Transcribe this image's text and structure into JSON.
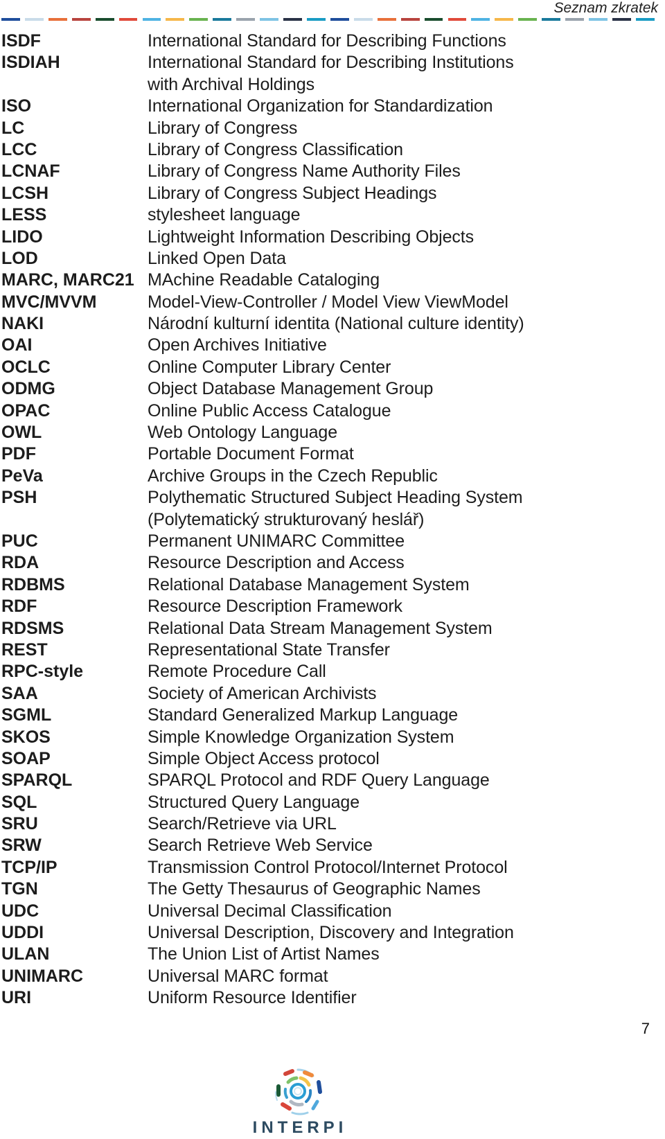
{
  "header": {
    "title": "Seznam zkratek",
    "dash_colors": [
      "#1f4e9c",
      "#c9dbe9",
      "#e8703a",
      "#b8443e",
      "#1a4d2e",
      "#e04a3a",
      "#4fb3e3",
      "#f6b74a",
      "#69b350",
      "#1a7a9c",
      "#9aa3ad",
      "#7ec3e4",
      "#2a3347",
      "#1a9cc4"
    ]
  },
  "abbreviations": [
    {
      "abbr": "ISDF",
      "desc": "International Standard for Describing Functions"
    },
    {
      "abbr": "ISDIAH",
      "desc": "International Standard for Describing Institutions"
    },
    {
      "abbr": "",
      "desc": "with Archival Holdings"
    },
    {
      "abbr": "ISO",
      "desc": "International Organization for Standardization"
    },
    {
      "abbr": "LC",
      "desc": "Library of Congress"
    },
    {
      "abbr": "LCC",
      "desc": "Library of Congress Classification"
    },
    {
      "abbr": "LCNAF",
      "desc": "Library of Congress Name Authority Files"
    },
    {
      "abbr": "LCSH",
      "desc": "Library of Congress Subject Headings"
    },
    {
      "abbr": "LESS",
      "desc": "stylesheet language"
    },
    {
      "abbr": "LIDO",
      "desc": "Lightweight Information Describing Objects"
    },
    {
      "abbr": "LOD",
      "desc": "Linked Open Data"
    },
    {
      "abbr": "MARC, MARC21",
      "desc": "MAchine Readable Cataloging"
    },
    {
      "abbr": "MVC/MVVM",
      "desc": "Model-View-Controller / Model View ViewModel"
    },
    {
      "abbr": "NAKI",
      "desc": "Národní kulturní identita (National culture identity)"
    },
    {
      "abbr": "OAI",
      "desc": "Open Archives Initiative"
    },
    {
      "abbr": "OCLC",
      "desc": "Online Computer Library Center"
    },
    {
      "abbr": "ODMG",
      "desc": "Object Database Management Group"
    },
    {
      "abbr": "OPAC",
      "desc": "Online Public Access Catalogue"
    },
    {
      "abbr": "OWL",
      "desc": "Web Ontology Language"
    },
    {
      "abbr": "PDF",
      "desc": "Portable Document Format"
    },
    {
      "abbr": "PeVa",
      "desc": "Archive Groups in the Czech Republic"
    },
    {
      "abbr": "PSH",
      "desc": "Polythematic Structured Subject Heading System"
    },
    {
      "abbr": "",
      "desc": "(Polytematický strukturovaný heslář)"
    },
    {
      "abbr": "PUC",
      "desc": "Permanent UNIMARC Committee"
    },
    {
      "abbr": "RDA",
      "desc": "Resource Description and Access"
    },
    {
      "abbr": "RDBMS",
      "desc": "Relational Database Management System"
    },
    {
      "abbr": "RDF",
      "desc": "Resource Description Framework"
    },
    {
      "abbr": "RDSMS",
      "desc": "Relational Data Stream Management System"
    },
    {
      "abbr": "REST",
      "desc": "Representational State Transfer"
    },
    {
      "abbr": "RPC-style",
      "desc": "Remote Procedure Call"
    },
    {
      "abbr": "SAA",
      "desc": "Society of American Archivists"
    },
    {
      "abbr": "SGML",
      "desc": "Standard Generalized Markup Language"
    },
    {
      "abbr": "SKOS",
      "desc": "Simple Knowledge Organization System"
    },
    {
      "abbr": "SOAP",
      "desc": "Simple Object Access protocol"
    },
    {
      "abbr": "SPARQL",
      "desc": "SPARQL Protocol and RDF Query Language"
    },
    {
      "abbr": "SQL",
      "desc": "Structured Query Language"
    },
    {
      "abbr": "SRU",
      "desc": "Search/Retrieve via URL"
    },
    {
      "abbr": "SRW",
      "desc": "Search Retrieve Web Service"
    },
    {
      "abbr": "TCP/IP",
      "desc": "Transmission Control Protocol/Internet Protocol"
    },
    {
      "abbr": "TGN",
      "desc": "The Getty Thesaurus of Geographic Names"
    },
    {
      "abbr": "UDC",
      "desc": "Universal Decimal Classification"
    },
    {
      "abbr": "UDDI",
      "desc": "Universal Description, Discovery and Integration"
    },
    {
      "abbr": "ULAN",
      "desc": "The Union List of Artist Names"
    },
    {
      "abbr": "UNIMARC",
      "desc": "Universal MARC format"
    },
    {
      "abbr": "URI",
      "desc": "Uniform Resource Identifier"
    }
  ],
  "footer": {
    "page_number": "7",
    "logo_text": "INTERPI",
    "logo_icon": "interpi-circular-logo-icon"
  }
}
